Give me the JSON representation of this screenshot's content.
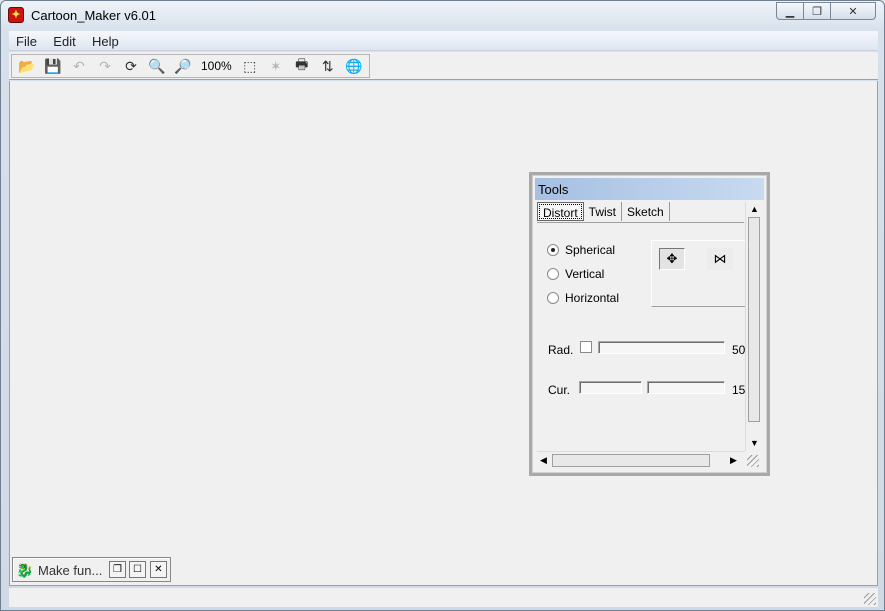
{
  "window": {
    "title": "Cartoon_Maker v6.01"
  },
  "menu": [
    "File",
    "Edit",
    "Help"
  ],
  "toolbar": {
    "buttons": [
      {
        "name": "open-icon",
        "glyph": "📂"
      },
      {
        "name": "save-icon",
        "glyph": "💾"
      },
      {
        "name": "undo-icon",
        "glyph": "↶",
        "disabled": true
      },
      {
        "name": "redo-icon",
        "glyph": "↷",
        "disabled": true
      },
      {
        "name": "refresh-icon",
        "glyph": "⟳"
      },
      {
        "name": "zoom-out-icon",
        "glyph": "🔍"
      },
      {
        "name": "zoom-in-icon",
        "glyph": "🔎"
      }
    ],
    "zoom": "100%"
  },
  "tools": {
    "title": "Tools",
    "tabs": [
      "Distort",
      "Twist",
      "Sketch"
    ],
    "active_tab": "Distort",
    "radios": [
      "Spherical",
      "Vertical",
      "Horizontal"
    ],
    "selected_radio": "Spherical",
    "rad_label": "Rad.",
    "rad_value": "50",
    "cur_label": "Cur.",
    "cur_value": "15"
  },
  "minimized_window": {
    "title": "Make fun..."
  }
}
